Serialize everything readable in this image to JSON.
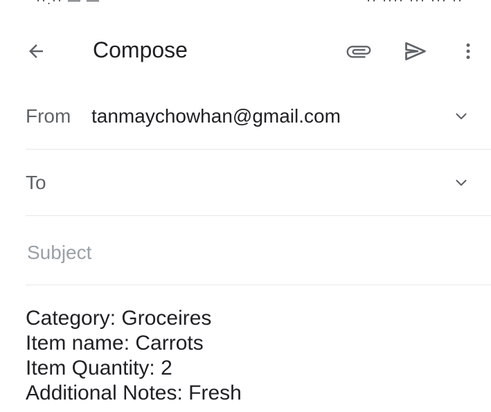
{
  "status_bar": {
    "left_glyphs": "··:·· — —",
    "right_glyphs": "·· ···· ··· ··· ··"
  },
  "toolbar": {
    "title": "Compose",
    "back_icon": "arrow-back-icon",
    "attach_icon": "paperclip-icon",
    "send_icon": "send-icon",
    "more_icon": "more-vert-icon"
  },
  "from": {
    "label": "From",
    "value": "tanmaychowhan@gmail.com"
  },
  "to": {
    "label": "To",
    "value": ""
  },
  "subject": {
    "placeholder": "Subject",
    "value": ""
  },
  "body": {
    "lines": [
      "Category: Groceires",
      "Item name: Carrots",
      "Item Quantity: 2",
      "Additional Notes: Fresh"
    ]
  },
  "colors": {
    "icon": "#5f6368",
    "text_primary": "#202124",
    "text_secondary": "#5f6368",
    "placeholder": "#9aa0a6",
    "divider": "#e6e6e6"
  }
}
